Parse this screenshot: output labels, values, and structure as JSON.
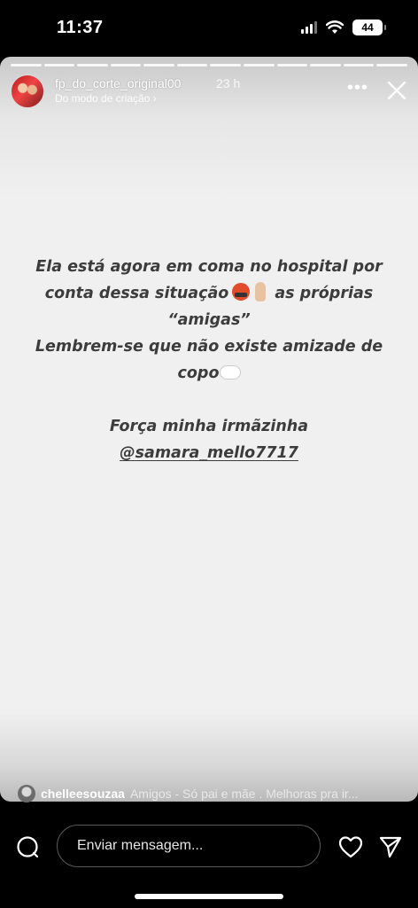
{
  "status_bar": {
    "time": "11:37",
    "battery": "44"
  },
  "story": {
    "segments": 12,
    "username": "fp_do_corte_original00",
    "time_ago": "23 h",
    "subtitle": "Do modo de criação ›",
    "text": {
      "line1": "Ela está agora em coma no hospital por",
      "line2a": "conta dessa situação",
      "line2b": "as próprias",
      "line3": "“amigas”",
      "line4": "Lembrem-se que não existe amizade de",
      "line5": "copo",
      "line6": "Força minha irmãzinha",
      "mention": "@samara_mello7717"
    },
    "reply": {
      "user": "chelleesouzaa",
      "text": "Amigos - Só pai e mãe . Melhoras pra ir..."
    }
  },
  "bottom": {
    "message_placeholder": "Enviar mensagem..."
  },
  "colors": {
    "story_background": "#f0f0f0",
    "story_text": "#3c3c3c",
    "chrome_background": "#000000"
  },
  "icons": [
    "signal-icon",
    "wifi-icon",
    "battery-icon",
    "more-icon",
    "close-icon",
    "camera-icon",
    "heart-icon",
    "send-icon"
  ]
}
